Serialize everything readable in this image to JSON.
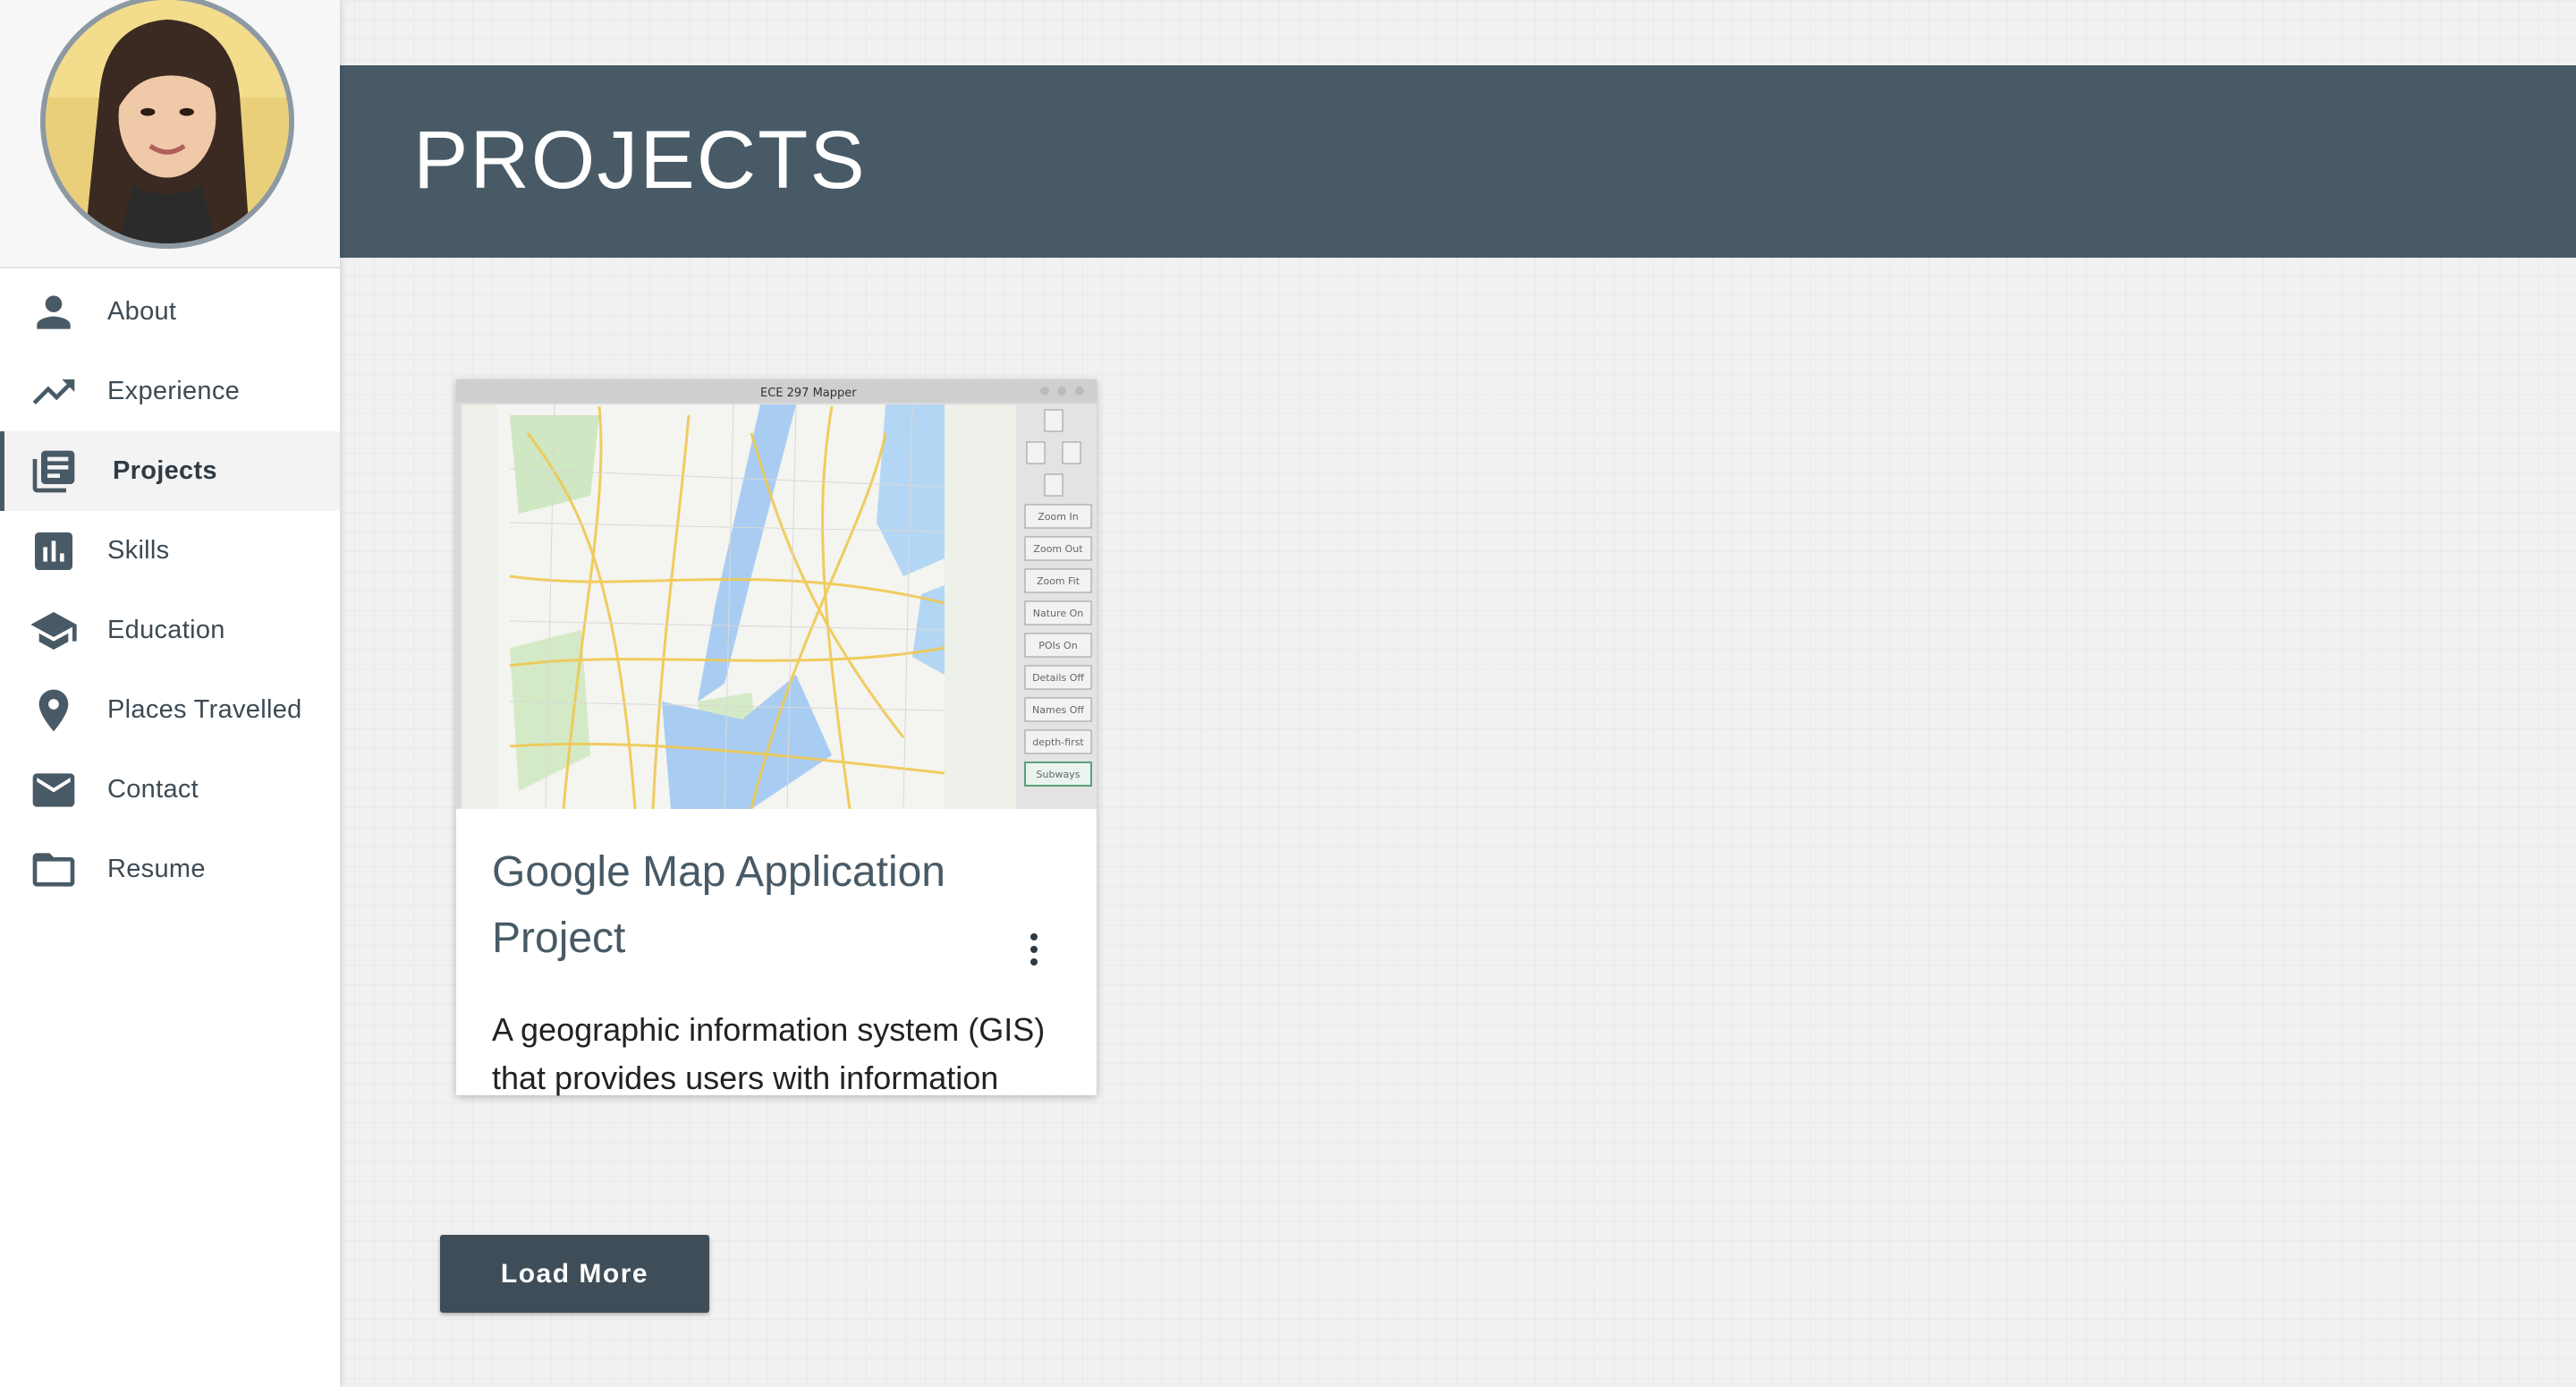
{
  "sidebar": {
    "avatar_alt": "Profile photo",
    "items": [
      {
        "label": "About",
        "icon": "person-icon",
        "active": false
      },
      {
        "label": "Experience",
        "icon": "trending-up-icon",
        "active": false
      },
      {
        "label": "Projects",
        "icon": "library-books-icon",
        "active": true
      },
      {
        "label": "Skills",
        "icon": "bar-chart-icon",
        "active": false
      },
      {
        "label": "Education",
        "icon": "graduation-cap-icon",
        "active": false
      },
      {
        "label": "Places Travelled",
        "icon": "location-pin-icon",
        "active": false
      },
      {
        "label": "Contact",
        "icon": "mail-icon",
        "active": false
      },
      {
        "label": "Resume",
        "icon": "folder-icon",
        "active": false
      }
    ]
  },
  "header": {
    "title": "PROJECTS"
  },
  "projects": [
    {
      "title": "Google Map Application Project",
      "description": "A geographic information system (GIS) that provides users with information",
      "image": {
        "window_title": "ECE 297 Mapper",
        "buttons": [
          "Zoom In",
          "Zoom Out",
          "Zoom Fit",
          "Nature On",
          "POIs On",
          "Details Off",
          "Names Off",
          "depth-first",
          "Subways"
        ]
      }
    }
  ],
  "load_more_label": "Load More",
  "colors": {
    "accent": "#485a66",
    "button": "#3e4d57",
    "background": "#f1f1f1"
  }
}
